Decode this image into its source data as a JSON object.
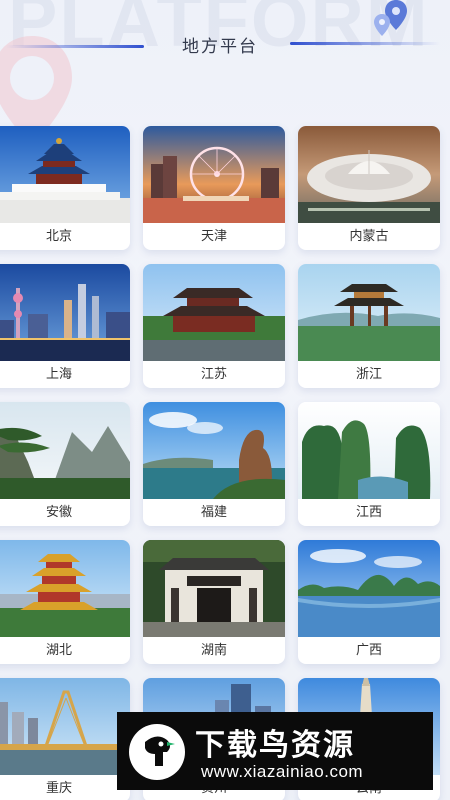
{
  "header": {
    "title": "地方平台",
    "watermark": "PLATFORM"
  },
  "regions": [
    {
      "label": "北京",
      "image": "temple-of-heaven-photo"
    },
    {
      "label": "天津",
      "image": "ferris-wheel-photo"
    },
    {
      "label": "内蒙古",
      "image": "stadium-photo"
    },
    {
      "label": "上海",
      "image": "city-skyline-photo"
    },
    {
      "label": "江苏",
      "image": "pavilion-photo"
    },
    {
      "label": "浙江",
      "image": "lakeside-pavilion-photo"
    },
    {
      "label": "安徽",
      "image": "mountain-pine-photo"
    },
    {
      "label": "福建",
      "image": "coastal-rock-photo"
    },
    {
      "label": "江西",
      "image": "river-mountains-photo"
    },
    {
      "label": "湖北",
      "image": "yellow-crane-tower-photo"
    },
    {
      "label": "湖南",
      "image": "academy-gate-photo"
    },
    {
      "label": "广西",
      "image": "karst-lake-photo"
    },
    {
      "label": "重庆",
      "image": "bridge-city-photo"
    },
    {
      "label": "贵州",
      "image": "city-tower-photo"
    },
    {
      "label": "云南",
      "image": "pagoda-photo"
    }
  ],
  "brand": {
    "name": "下载鸟资源",
    "url": "www.xiazainiao.com"
  },
  "colors": {
    "accent": "#2f4fcf",
    "background": "#eef1f9",
    "card": "#ffffff"
  }
}
